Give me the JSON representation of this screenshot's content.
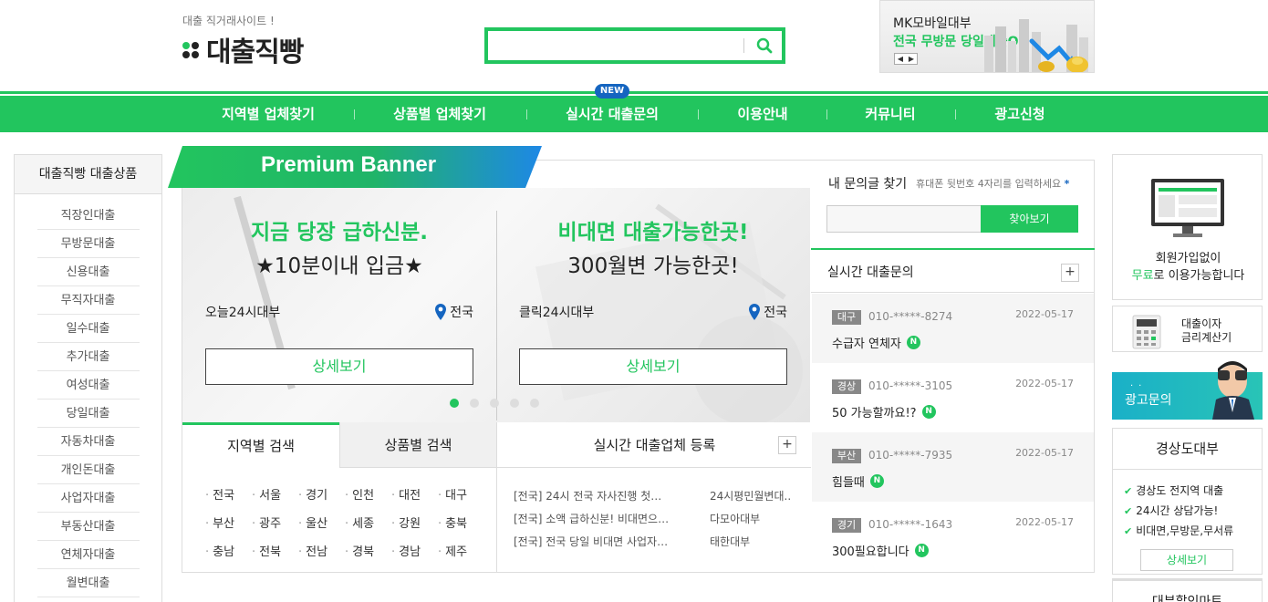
{
  "header": {
    "tagline": "대출 직거래사이트 !",
    "logo_text": "대출직빵",
    "search_placeholder": "",
    "mk_banner": {
      "title": "MK모바일대부",
      "subtitle": "전국 무방문 당일대출OK"
    }
  },
  "nav": {
    "items": [
      "지역별 업체찾기",
      "상품별 업체찾기",
      "실시간 대출문의",
      "이용안내",
      "커뮤니티",
      "광고신청"
    ],
    "new_badge": "NEW"
  },
  "sidebar": {
    "title": "대출직빵 대출상품",
    "items": [
      "직장인대출",
      "무방문대출",
      "신용대출",
      "무직자대출",
      "일수대출",
      "추가대출",
      "여성대출",
      "당일대출",
      "자동차대출",
      "개인돈대출",
      "사업자대출",
      "부동산대출",
      "연체자대출",
      "월변대출"
    ]
  },
  "premium": {
    "label": "Premium Banner",
    "cards": [
      {
        "line1": "지금 당장 급하신분.",
        "line2": "★10분이내 입금★",
        "company": "오늘24시대부",
        "region": "전국",
        "button": "상세보기"
      },
      {
        "line1": "비대면 대출가능한곳!",
        "line2": "300월변 가능한곳!",
        "company": "클릭24시대부",
        "region": "전국",
        "button": "상세보기"
      }
    ],
    "slide_count": 5,
    "active_slide": 0
  },
  "search_tabs": {
    "tab_region": "지역별 검색",
    "tab_product": "상품별 검색",
    "regions": [
      "전국",
      "서울",
      "경기",
      "인천",
      "대전",
      "대구",
      "부산",
      "광주",
      "울산",
      "세종",
      "강원",
      "충북",
      "충남",
      "전북",
      "전남",
      "경북",
      "경남",
      "제주"
    ]
  },
  "registration": {
    "title": "실시간 대출업체 등록",
    "plus": "+",
    "rows": [
      {
        "title": "[전국] 24시 전국 자사진행 첫…",
        "company": "24시평민월변대.."
      },
      {
        "title": "[전국] 소액 급하신분! 비대면으…",
        "company": "다모아대부"
      },
      {
        "title": "[전국] 전국 당일 비대면 사업자…",
        "company": "태한대부"
      }
    ]
  },
  "inquiry": {
    "heading": "내 문의글 찾기",
    "note": "휴대폰 뒷번호 4자리를 입력하세요",
    "note_star": "*",
    "button": "찾아보기",
    "realtime_title": "실시간 대출문의",
    "plus": "+",
    "items": [
      {
        "tag": "대구",
        "phone": "010-*****-8274",
        "date": "2022-05-17",
        "text": "수급자 연체자",
        "badge": "N"
      },
      {
        "tag": "경상",
        "phone": "010-*****-3105",
        "date": "2022-05-17",
        "text": "50 가능할까요!?",
        "badge": "N"
      },
      {
        "tag": "부산",
        "phone": "010-*****-7935",
        "date": "2022-05-17",
        "text": "힘들때",
        "badge": "N"
      },
      {
        "tag": "경기",
        "phone": "010-*****-1643",
        "date": "2022-05-17",
        "text": "300필요합니다",
        "badge": "N"
      }
    ]
  },
  "right_ads": {
    "signup_line1": "회원가입없이",
    "signup_free": "무료",
    "signup_line2": "로 이용가능합니다",
    "calc_line1": "대출이자",
    "calc_line2": "금리계산기",
    "ad_inquiry": "광고문의",
    "kd_title": "경상도대부",
    "kd_items": [
      "경상도 전지역 대출",
      "24시간 상담가능!",
      "비대면,무방문,무서류"
    ],
    "kd_button": "상세보기",
    "mart": "대부할인마트"
  },
  "colors": {
    "brand": "#22c55e",
    "blue": "#1565c0"
  }
}
